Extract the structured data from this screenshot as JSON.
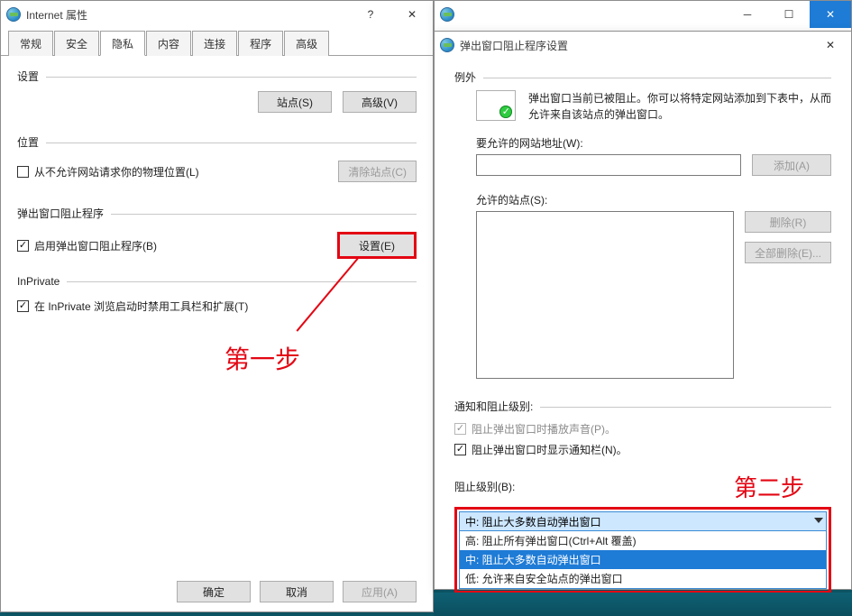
{
  "win1": {
    "title": "Internet 属性",
    "tabs": [
      "常规",
      "安全",
      "隐私",
      "内容",
      "连接",
      "程序",
      "高级"
    ],
    "active_tab": 2,
    "settings_label": "设置",
    "btn_sites": "站点(S)",
    "btn_advanced": "高级(V)",
    "location_label": "位置",
    "loc_checkbox_label": "从不允许网站请求你的物理位置(L)",
    "btn_clear_sites": "清除站点(C)",
    "popup_section_label": "弹出窗口阻止程序",
    "popup_enable_label": "启用弹出窗口阻止程序(B)",
    "btn_settings": "设置(E)",
    "inprivate_label": "InPrivate",
    "inprivate_checkbox_label": "在 InPrivate 浏览启动时禁用工具栏和扩展(T)",
    "btn_ok": "确定",
    "btn_cancel": "取消",
    "btn_apply": "应用(A)"
  },
  "win2": {
    "title": "弹出窗口阻止程序设置",
    "exceptions_label": "例外",
    "info_text": "弹出窗口当前已被阻止。你可以将特定网站添加到下表中，从而允许来自该站点的弹出窗口。",
    "allow_addr_label": "要允许的网站地址(W):",
    "btn_add": "添加(A)",
    "allowed_sites_label": "允许的站点(S):",
    "btn_delete": "删除(R)",
    "btn_delete_all": "全部删除(E)...",
    "notify_section_label": "通知和阻止级别:",
    "cb_play_sound": "阻止弹出窗口时播放声音(P)。",
    "cb_show_bar": "阻止弹出窗口时显示通知栏(N)。",
    "block_level_label": "阻止级别(B):",
    "selected_level": "中: 阻止大多数自动弹出窗口",
    "level_options": [
      "高: 阻止所有弹出窗口(Ctrl+Alt 覆盖)",
      "中: 阻止大多数自动弹出窗口",
      "低: 允许来自安全站点的弹出窗口"
    ]
  },
  "annotations": {
    "step1": "第一步",
    "step2": "第二步"
  },
  "colors": {
    "accent_red": "#e30613",
    "select_blue": "#1e7bd6"
  }
}
